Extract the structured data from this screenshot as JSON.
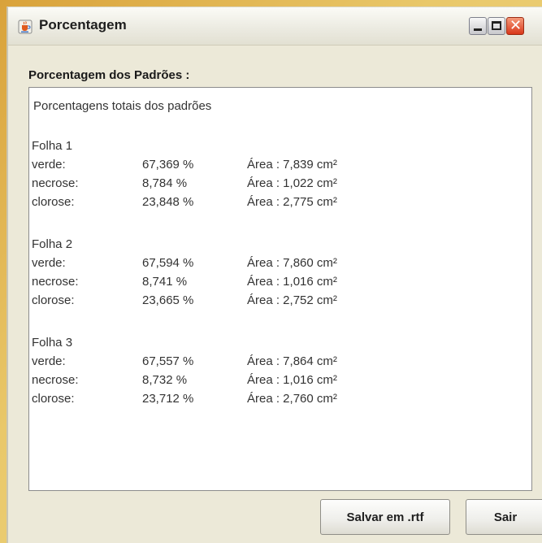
{
  "window": {
    "title": "Porcentagem",
    "icon": "java-cup-icon",
    "controls": [
      "minimize-icon",
      "maximize-icon",
      "close-icon"
    ]
  },
  "section_label": "Porcentagem dos Padrões :",
  "report": {
    "heading": "Porcentagens totais dos padrões",
    "groups": [
      {
        "title": "Folha 1",
        "rows": [
          {
            "name": "verde:",
            "pct": "67,369 %",
            "area": "Área : 7,839 cm²"
          },
          {
            "name": "necrose:",
            "pct": "8,784 %",
            "area": "Área : 1,022 cm²"
          },
          {
            "name": "clorose:",
            "pct": "23,848 %",
            "area": "Área : 2,775 cm²"
          }
        ]
      },
      {
        "title": "Folha 2",
        "rows": [
          {
            "name": "verde:",
            "pct": "67,594 %",
            "area": "Área : 7,860 cm²"
          },
          {
            "name": "necrose:",
            "pct": "8,741 %",
            "area": "Área : 1,016 cm²"
          },
          {
            "name": "clorose:",
            "pct": "23,665 %",
            "area": "Área : 2,752 cm²"
          }
        ]
      },
      {
        "title": "Folha 3",
        "rows": [
          {
            "name": "verde:",
            "pct": "67,557 %",
            "area": "Área : 7,864 cm²"
          },
          {
            "name": "necrose:",
            "pct": "8,732 %",
            "area": "Área : 1,016 cm²"
          },
          {
            "name": "clorose:",
            "pct": "23,712 %",
            "area": "Área : 2,760 cm²"
          }
        ]
      }
    ]
  },
  "buttons": {
    "save_label": "Salvar em .rtf",
    "exit_label": "Sair"
  },
  "colors": {
    "close_button": "#d9371a",
    "window_background": "#ece9d8"
  }
}
